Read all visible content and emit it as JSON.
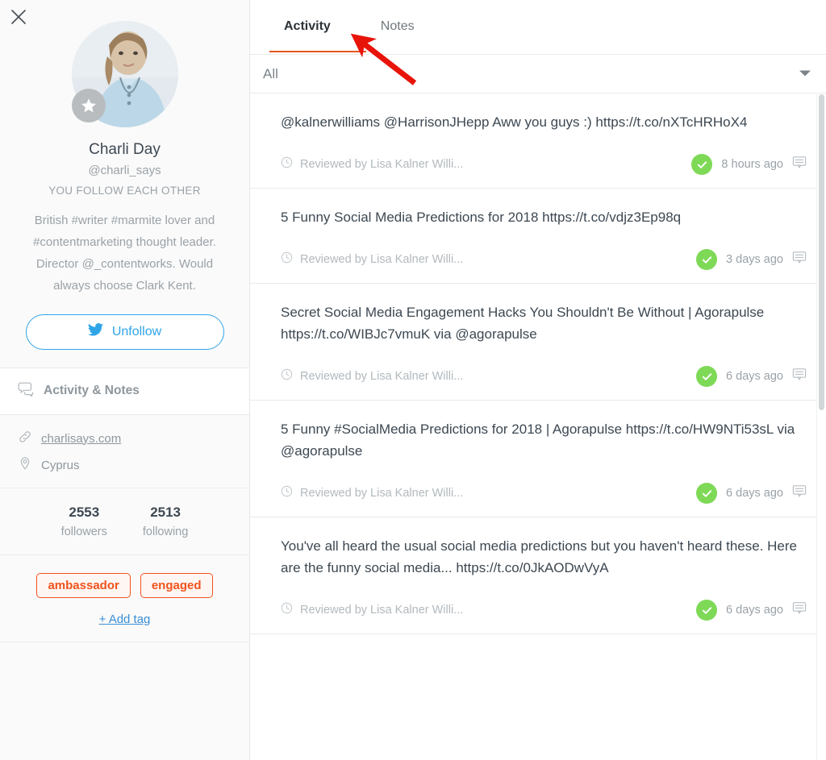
{
  "sidebar": {
    "close_icon": "close-icon",
    "profile": {
      "avatar_icon": "avatar",
      "badge_icon": "star-badge-icon",
      "full_name": "Charli Day",
      "handle": "@charli_says",
      "relationship": "YOU FOLLOW EACH OTHER",
      "bio": "British #writer #marmite lover and #contentmarketing thought leader. Director @_contentworks. Would always choose Clark Kent.",
      "follow_button": {
        "label": "Unfollow",
        "icon": "twitter-bird-icon",
        "color": "#2fa5e8"
      }
    },
    "activity_notes_row": {
      "label": "Activity & Notes",
      "icon": "speech-bubbles-icon"
    },
    "meta": {
      "website_icon": "link-icon",
      "website": "charlisays.com",
      "location_icon": "map-pin-icon",
      "location": "Cyprus"
    },
    "stats": [
      {
        "number": "2553",
        "caption": "followers"
      },
      {
        "number": "2513",
        "caption": "following"
      }
    ],
    "tags": {
      "pills": [
        "ambassador",
        "engaged"
      ],
      "add_label": "+ Add tag",
      "pill_color": "#f0531c",
      "add_color": "#3b8fd4"
    }
  },
  "main": {
    "tabs": [
      {
        "label": "Activity",
        "active": true
      },
      {
        "label": "Notes",
        "active": false
      }
    ],
    "active_tab_underline_color": "#e8581e",
    "filter": {
      "value": "All",
      "chevron_icon": "chevron-down-icon"
    },
    "feed": [
      {
        "text": "@kalnerwilliams @HarrisonJHepp Aww you guys :) https://t.co/nXTcHRHoX4",
        "clock_icon": "clock-icon",
        "reviewed_by": "Reviewed by Lisa Kalner Willi...",
        "status_icon": "check-circle-icon",
        "status_color": "#7ed957",
        "timestamp": "8 hours ago",
        "comment_icon": "comment-icon"
      },
      {
        "text": "5 Funny Social Media Predictions for 2018 https://t.co/vdjz3Ep98q",
        "clock_icon": "clock-icon",
        "reviewed_by": "Reviewed by Lisa Kalner Willi...",
        "status_icon": "check-circle-icon",
        "status_color": "#7ed957",
        "timestamp": "3 days ago",
        "comment_icon": "comment-icon"
      },
      {
        "text": "Secret Social Media Engagement Hacks You Shouldn't Be Without | Agorapulse https://t.co/WIBJc7vmuK via @agorapulse",
        "clock_icon": "clock-icon",
        "reviewed_by": "Reviewed by Lisa Kalner Willi...",
        "status_icon": "check-circle-icon",
        "status_color": "#7ed957",
        "timestamp": "6 days ago",
        "comment_icon": "comment-icon"
      },
      {
        "text": "5 Funny #SocialMedia Predictions for 2018 | Agorapulse https://t.co/HW9NTi53sL via @agorapulse",
        "clock_icon": "clock-icon",
        "reviewed_by": "Reviewed by Lisa Kalner Willi...",
        "status_icon": "check-circle-icon",
        "status_color": "#7ed957",
        "timestamp": "6 days ago",
        "comment_icon": "comment-icon"
      },
      {
        "text": "You've all heard the usual social media predictions but you haven't heard these. Here are the funny social media... https://t.co/0JkAODwVyA",
        "clock_icon": "clock-icon",
        "reviewed_by": "Reviewed by Lisa Kalner Willi...",
        "status_icon": "check-circle-icon",
        "status_color": "#7ed957",
        "timestamp": "6 days ago",
        "comment_icon": "comment-icon"
      }
    ],
    "scrollbar": {
      "name": "vertical-scrollbar"
    }
  },
  "annotation": {
    "arrow_icon": "red-arrow-annotation",
    "color": "#e81309"
  }
}
